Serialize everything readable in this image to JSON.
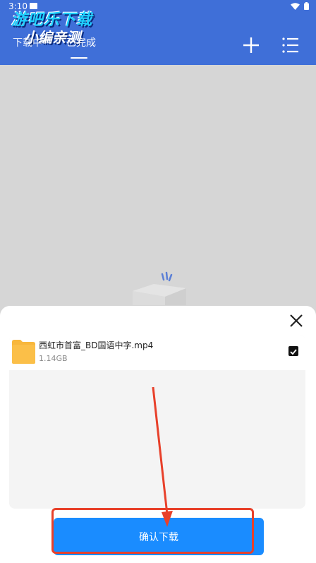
{
  "status_bar": {
    "time": "3:10"
  },
  "watermark": {
    "line1": "游吧乐下载",
    "line2": "小编亲测"
  },
  "tabs": [
    {
      "label": "下载中",
      "active": false
    },
    {
      "label": "已完成",
      "active": true
    }
  ],
  "toolbar": {
    "add_icon": "plus-icon",
    "list_icon": "list-icon"
  },
  "sheet": {
    "file": {
      "name": "西虹市首富_BD国语中字.mp4",
      "size": "1.14GB",
      "checked": true
    },
    "confirm_label": "确认下载"
  },
  "colors": {
    "appbar": "#3f6fd8",
    "primary_button": "#1a8cff",
    "folder": "#f8b73c",
    "annotation": "#e8402a"
  }
}
